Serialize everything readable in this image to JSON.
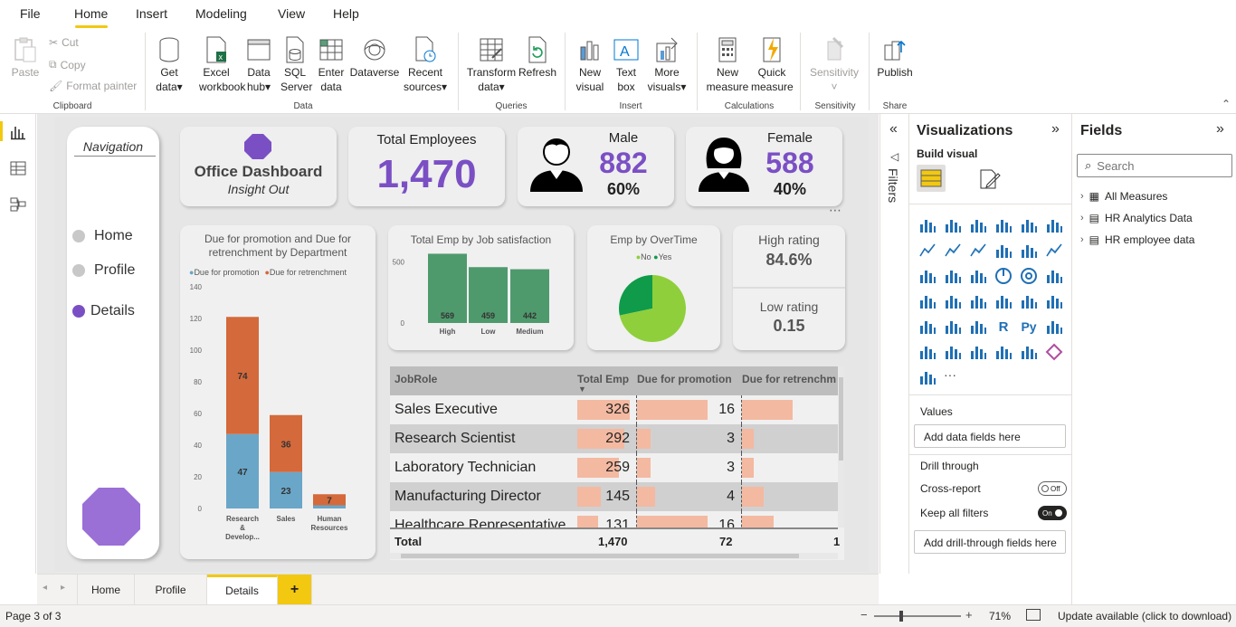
{
  "menu": {
    "items": [
      "File",
      "Home",
      "Insert",
      "Modeling",
      "View",
      "Help"
    ],
    "active": "Home"
  },
  "ribbon": {
    "clipboard": {
      "paste": "Paste",
      "cut": "Cut",
      "copy": "Copy",
      "format_painter": "Format painter",
      "label": "Clipboard"
    },
    "data": {
      "get_data_1": "Get",
      "get_data_2": "data",
      "excel_1": "Excel",
      "excel_2": "workbook",
      "datahub_1": "Data",
      "datahub_2": "hub",
      "sql_1": "SQL",
      "sql_2": "Server",
      "enter_1": "Enter",
      "enter_2": "data",
      "dataverse": "Dataverse",
      "recent_1": "Recent",
      "recent_2": "sources",
      "label": "Data"
    },
    "queries": {
      "transform_1": "Transform",
      "transform_2": "data",
      "refresh": "Refresh",
      "label": "Queries"
    },
    "insert": {
      "newvisual_1": "New",
      "newvisual_2": "visual",
      "textbox_1": "Text",
      "textbox_2": "box",
      "more_1": "More",
      "more_2": "visuals",
      "label": "Insert"
    },
    "calculations": {
      "newmeasure_1": "New",
      "newmeasure_2": "measure",
      "quick_1": "Quick",
      "quick_2": "measure",
      "label": "Calculations"
    },
    "sensitivity": {
      "btn": "Sensitivity",
      "label": "Sensitivity"
    },
    "share": {
      "publish": "Publish",
      "label": "Share"
    }
  },
  "navigation": {
    "title": "Navigation",
    "links": [
      "Home",
      "Profile",
      "Details"
    ],
    "active": "Details"
  },
  "header_card": {
    "title": "Office Dashboard",
    "subtitle": "Insight Out"
  },
  "kpi_total": {
    "label": "Total Employees",
    "value": "1,470"
  },
  "kpi_male": {
    "label": "Male",
    "value": "882",
    "pct": "60%"
  },
  "kpi_female": {
    "label": "Female",
    "value": "588",
    "pct": "40%"
  },
  "rating": {
    "high_label": "High rating",
    "high_value": "84.6%",
    "low_label": "Low rating",
    "low_value": "0.15"
  },
  "chart_data": [
    {
      "type": "bar",
      "title": "Due for promotion and Due for retrenchment by Department",
      "categories": [
        "Research & Develop...",
        "Sales",
        "Human Resources"
      ],
      "series": [
        {
          "name": "Due for promotion",
          "values": [
            47,
            23,
            2
          ],
          "labels": [
            "47",
            "23",
            ""
          ],
          "color": "#6aa6c8"
        },
        {
          "name": "Due for retrenchment",
          "values": [
            74,
            36,
            7
          ],
          "labels": [
            "74",
            "36",
            "7"
          ],
          "color": "#d4693b"
        }
      ],
      "ylim": [
        0,
        140
      ],
      "yticks": [
        "0",
        "20",
        "40",
        "60",
        "80",
        "100",
        "120",
        "140"
      ]
    },
    {
      "type": "bar",
      "title": "Total Emp by Job satisfaction",
      "categories": [
        "High",
        "Low",
        "Medium"
      ],
      "values": [
        569,
        459,
        442
      ],
      "labels": [
        "569",
        "459",
        "442"
      ],
      "yticks": [
        "0",
        "500"
      ],
      "ylim": [
        0,
        550
      ],
      "color": "#4f9a6d"
    },
    {
      "type": "pie",
      "title": "Emp by OverTime",
      "series": [
        {
          "name": "No",
          "value": 1054,
          "color": "#8fcf3c"
        },
        {
          "name": "Yes",
          "value": 416,
          "color": "#0f9b4a"
        }
      ]
    }
  ],
  "table": {
    "headers": [
      "JobRole",
      "Total Emp",
      "Due for promotion",
      "Due for retrenchm"
    ],
    "rows": [
      {
        "role": "Sales Executive",
        "total": "326",
        "total_v": 326,
        "promo": "16",
        "promo_v": 16,
        "retr_v": 60
      },
      {
        "role": "Research Scientist",
        "total": "292",
        "total_v": 292,
        "promo": "3",
        "promo_v": 3,
        "retr_v": 14
      },
      {
        "role": "Laboratory Technician",
        "total": "259",
        "total_v": 259,
        "promo": "3",
        "promo_v": 3,
        "retr_v": 14
      },
      {
        "role": "Manufacturing Director",
        "total": "145",
        "total_v": 145,
        "promo": "4",
        "promo_v": 4,
        "retr_v": 26
      },
      {
        "role": "Healthcare Representative",
        "total": "131",
        "total_v": 131,
        "promo": "16",
        "promo_v": 16,
        "retr_v": 38
      }
    ],
    "total": {
      "label": "Total",
      "total": "1,470",
      "promo": "72",
      "retr": "1"
    }
  },
  "filters": {
    "label": "Filters"
  },
  "visualizations": {
    "title": "Visualizations",
    "build_visual": "Build visual",
    "values_label": "Values",
    "values_placeholder": "Add data fields here",
    "drill_label": "Drill through",
    "cross_report": "Cross-report",
    "cross_state": "Off",
    "keep_filters": "Keep all filters",
    "keep_state": "On",
    "drill_placeholder": "Add drill-through fields here",
    "more": "···"
  },
  "fields": {
    "title": "Fields",
    "search_placeholder": "Search",
    "items": [
      "All Measures",
      "HR Analytics Data",
      "HR employee data"
    ]
  },
  "page_tabs": [
    "Home",
    "Profile",
    "Details"
  ],
  "active_tab": "Details",
  "status": {
    "page": "Page 3 of 3",
    "zoom": "71%",
    "update": "Update available (click to download)"
  },
  "colors": {
    "accent": "#F2C811",
    "purple": "#7B4FC4",
    "nav_purple": "#7B4FC4"
  }
}
